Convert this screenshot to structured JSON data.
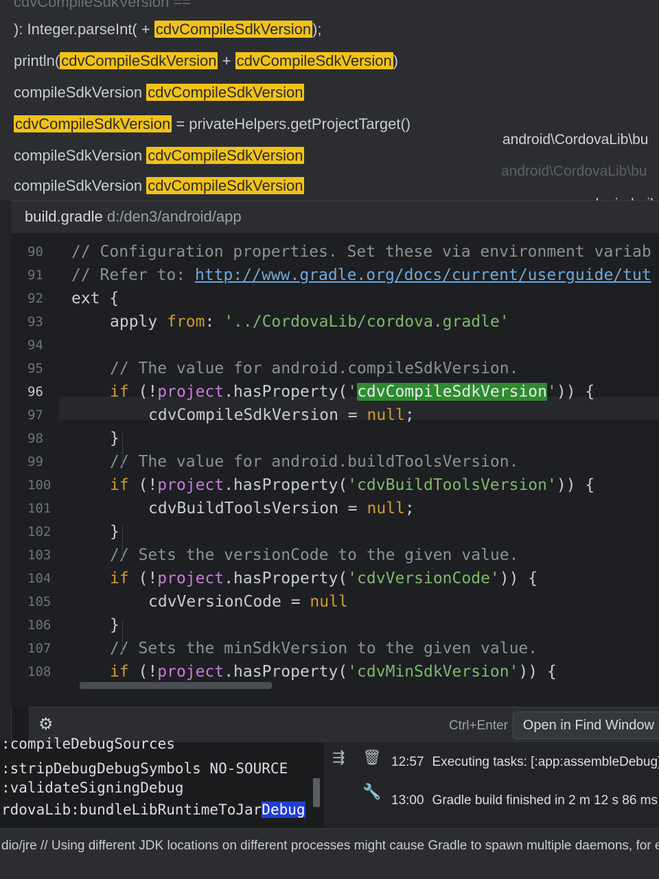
{
  "results": {
    "top_cut": "cdvCompileSdkVersion ==",
    "rows": [
      {
        "prefix": "): Integer.parseInt(",
        "mid": " + ",
        "hl": "cdvCompileSdkVersion",
        "suffix": ");"
      },
      {
        "prefix": "println(",
        "hl": "cdvCompileSdkVersion",
        "mid": " + ",
        "hl2": "cdvCompileSdkVersion",
        "suffix": ")"
      },
      {
        "prefix": "compileSdkVersion ",
        "hl": "cdvCompileSdkVersion"
      },
      {
        "hl": "cdvCompileSdkVersion",
        "suffix": " = privateHelpers.getProjectTarget()"
      },
      {
        "prefix": "compileSdkVersion ",
        "hl": "cdvCompileSdkVersion"
      },
      {
        "prefix": "compileSdkVersion ",
        "hl": "cdvCompileSdkVersion"
      }
    ],
    "paths": [
      "android\\CordovaLib\\bu",
      "android\\CordovaLib\\bu",
      "plugin-buil"
    ]
  },
  "preview": {
    "file_name": "build.gradle",
    "file_dir": "d:/den3/android/app"
  },
  "editor": {
    "lines": [
      {
        "n": "90",
        "indent": 0,
        "parts": [
          {
            "c": "cmt",
            "t": "// Configuration properties. Set these via environment variab"
          }
        ]
      },
      {
        "n": "91",
        "indent": 0,
        "parts": [
          {
            "c": "cmt",
            "t": "// Refer to: "
          },
          {
            "c": "url",
            "t": "http://www.gradle.org/docs/current/userguide/tut"
          }
        ]
      },
      {
        "n": "92",
        "indent": 0,
        "parts": [
          {
            "c": "",
            "t": "ext {"
          }
        ]
      },
      {
        "n": "93",
        "indent": 1,
        "parts": [
          {
            "c": "",
            "t": "apply "
          },
          {
            "c": "kw",
            "t": "from"
          },
          {
            "c": "",
            "t": ": "
          },
          {
            "c": "str",
            "t": "'../CordovaLib/cordova.gradle'"
          }
        ]
      },
      {
        "n": "94",
        "indent": 0,
        "parts": []
      },
      {
        "n": "95",
        "indent": 1,
        "parts": [
          {
            "c": "cmt",
            "t": "// The value for android.compileSdkVersion."
          }
        ]
      },
      {
        "n": "96",
        "indent": 1,
        "cur": true,
        "parts": [
          {
            "c": "kw",
            "t": "if "
          },
          {
            "c": "",
            "t": "(!"
          },
          {
            "c": "prop",
            "t": "project"
          },
          {
            "c": "",
            "t": ".hasProperty("
          },
          {
            "c": "str",
            "t": "'"
          },
          {
            "c": "match",
            "t": "cdvCompileSdkVersion"
          },
          {
            "c": "str",
            "t": "'"
          },
          {
            "c": "",
            "t": ")) {"
          }
        ]
      },
      {
        "n": "97",
        "indent": 2,
        "parts": [
          {
            "c": "",
            "t": "cdvCompileSdkVersion = "
          },
          {
            "c": "kw",
            "t": "null"
          },
          {
            "c": "",
            "t": ";"
          }
        ]
      },
      {
        "n": "98",
        "indent": 1,
        "parts": [
          {
            "c": "",
            "t": "}"
          }
        ]
      },
      {
        "n": "99",
        "indent": 1,
        "parts": [
          {
            "c": "cmt",
            "t": "// The value for android.buildToolsVersion."
          }
        ]
      },
      {
        "n": "100",
        "indent": 1,
        "parts": [
          {
            "c": "kw",
            "t": "if "
          },
          {
            "c": "",
            "t": "(!"
          },
          {
            "c": "prop",
            "t": "project"
          },
          {
            "c": "",
            "t": ".hasProperty("
          },
          {
            "c": "str",
            "t": "'cdvBuildToolsVersion'"
          },
          {
            "c": "",
            "t": ")) {"
          }
        ]
      },
      {
        "n": "101",
        "indent": 2,
        "parts": [
          {
            "c": "",
            "t": "cdvBuildToolsVersion = "
          },
          {
            "c": "kw",
            "t": "null"
          },
          {
            "c": "",
            "t": ";"
          }
        ]
      },
      {
        "n": "102",
        "indent": 1,
        "parts": [
          {
            "c": "",
            "t": "}"
          }
        ]
      },
      {
        "n": "103",
        "indent": 1,
        "parts": [
          {
            "c": "cmt",
            "t": "// Sets the versionCode to the given value."
          }
        ]
      },
      {
        "n": "104",
        "indent": 1,
        "parts": [
          {
            "c": "kw",
            "t": "if "
          },
          {
            "c": "",
            "t": "(!"
          },
          {
            "c": "prop",
            "t": "project"
          },
          {
            "c": "",
            "t": ".hasProperty("
          },
          {
            "c": "str",
            "t": "'cdvVersionCode'"
          },
          {
            "c": "",
            "t": ")) {"
          }
        ]
      },
      {
        "n": "105",
        "indent": 2,
        "parts": [
          {
            "c": "",
            "t": "cdvVersionCode = "
          },
          {
            "c": "kw",
            "t": "null"
          }
        ]
      },
      {
        "n": "106",
        "indent": 1,
        "parts": [
          {
            "c": "",
            "t": "}"
          }
        ]
      },
      {
        "n": "107",
        "indent": 1,
        "parts": [
          {
            "c": "cmt",
            "t": "// Sets the minSdkVersion to the given value."
          }
        ]
      },
      {
        "n": "108",
        "indent": 1,
        "parts": [
          {
            "c": "kw",
            "t": "if "
          },
          {
            "c": "",
            "t": "(!"
          },
          {
            "c": "prop",
            "t": "project"
          },
          {
            "c": "",
            "t": ".hasProperty("
          },
          {
            "c": "str",
            "t": "'cdvMinSdkVersion'"
          },
          {
            "c": "",
            "t": ")) {"
          }
        ]
      }
    ]
  },
  "footer": {
    "settings_icon": "gear-icon",
    "shortcut": "Ctrl+Enter",
    "open_button": "Open in Find Window"
  },
  "build_output": {
    "lines": [
      ":compileDebugSources",
      ":stripDebugDebugSymbols NO-SOURCE",
      ":validateSigningDebug"
    ],
    "last_line_prefix": "rdovaLib:bundleLibRuntimeToJar",
    "last_line_selected": "Debug"
  },
  "events": [
    {
      "time": "12:57",
      "text": "Executing tasks: [:app:assembleDebug] i"
    },
    {
      "time": "13:00",
      "text": "Gradle build finished in 2 m 12 s 86 ms"
    }
  ],
  "status": {
    "text": "dio/jre // Using different JDK locations on different processes might cause Gradle to spawn multiple daemons, for exan"
  },
  "colors": {
    "highlight": "#f2c21a",
    "match": "#2e8b2e",
    "selection": "#1f3fd6"
  }
}
